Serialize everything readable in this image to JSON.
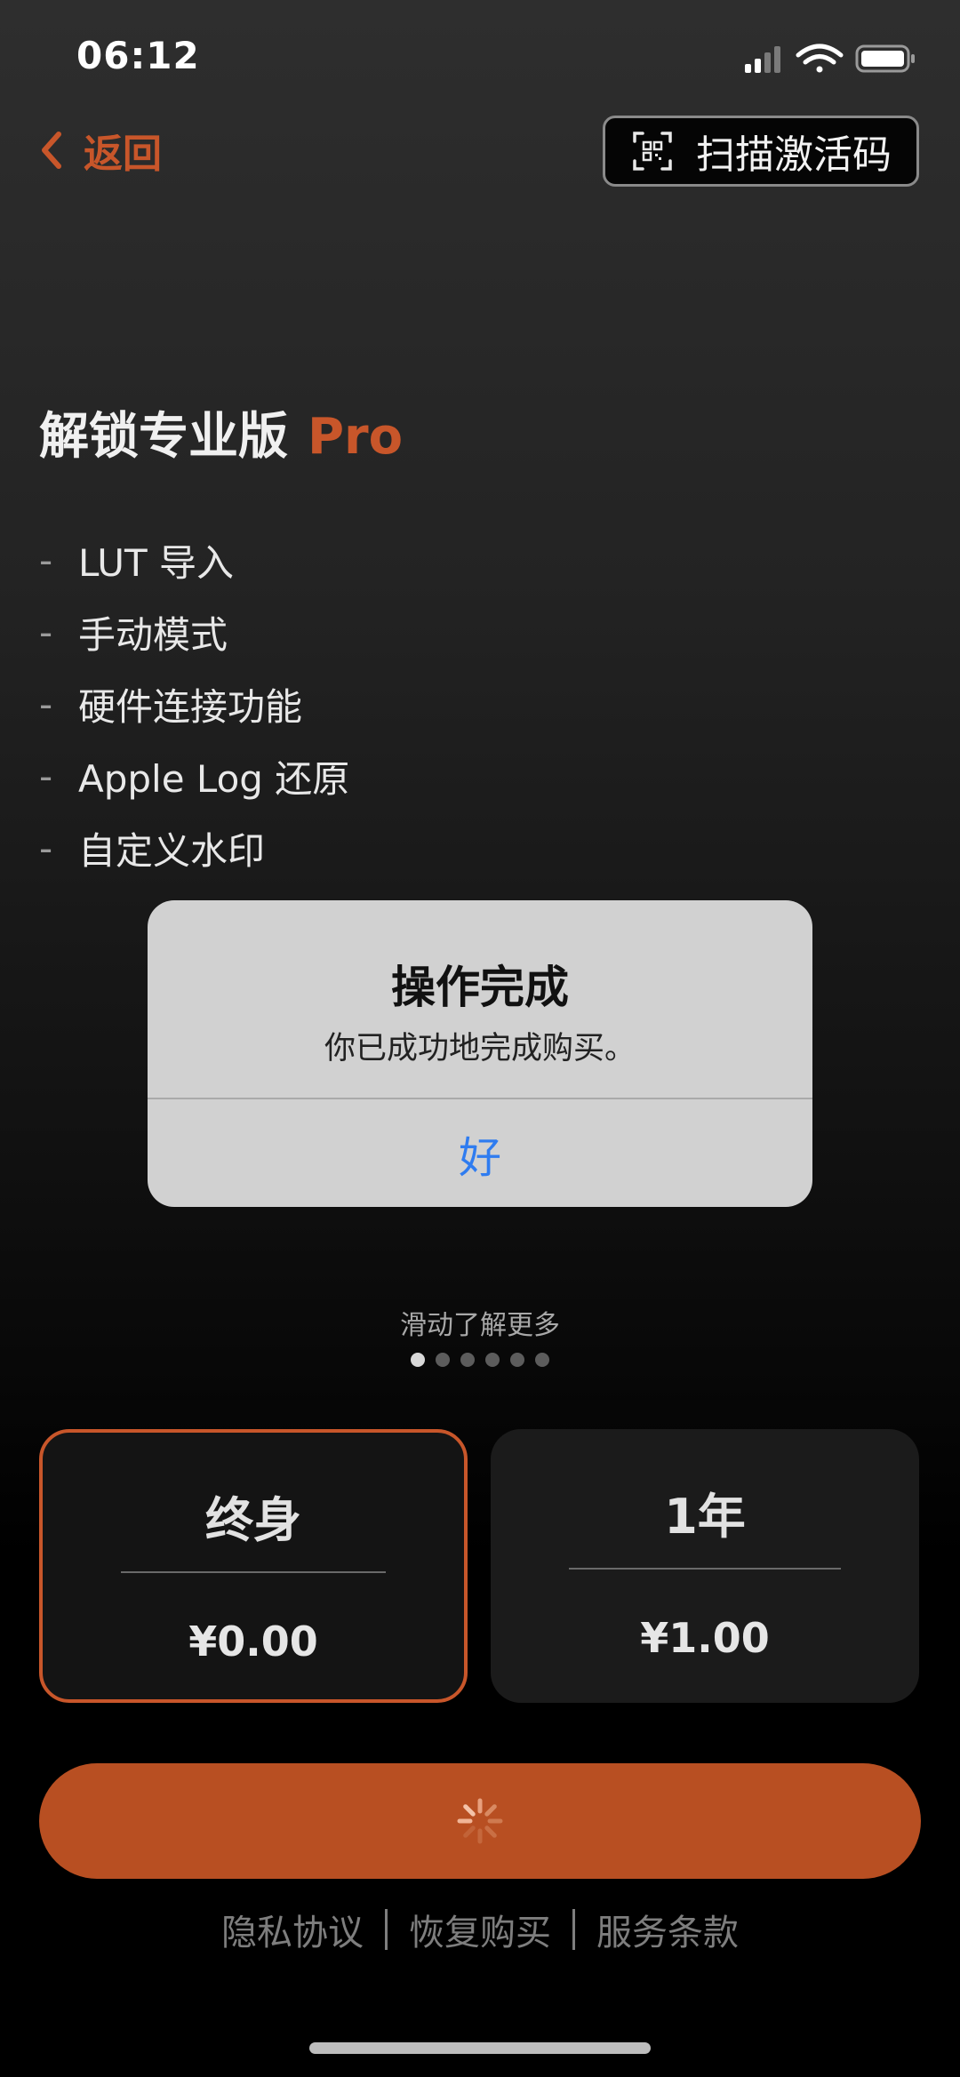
{
  "status_bar": {
    "time": "06:12",
    "icons": [
      "signal-icon",
      "wifi-icon",
      "battery-icon"
    ]
  },
  "nav": {
    "back_label": "返回",
    "back_icon": "chevron-left-icon",
    "scan_label": "扫描激活码",
    "scan_icon": "qr-scan-icon"
  },
  "headline": {
    "text": "解锁专业版",
    "accent": "Pro"
  },
  "features": [
    {
      "dash": "-",
      "text": "LUT 导入"
    },
    {
      "dash": "-",
      "text": "手动模式"
    },
    {
      "dash": "-",
      "text": "硬件连接功能"
    },
    {
      "dash": "-",
      "text": "Apple Log 还原"
    },
    {
      "dash": "-",
      "text": "自定义水印"
    }
  ],
  "alert": {
    "title": "操作完成",
    "message": "你已成功地完成购买。",
    "ok_label": "好"
  },
  "pager": {
    "hint": "滑动了解更多",
    "page_count": 6,
    "current_page": 1
  },
  "plans": [
    {
      "name": "终身",
      "price": "¥0.00",
      "selected": true
    },
    {
      "name": "1年",
      "price": "¥1.00",
      "selected": false
    }
  ],
  "purchase_button": {
    "state": "loading",
    "icon": "spinner-icon"
  },
  "footer": {
    "privacy": "隐私协议",
    "restore": "恢复购买",
    "terms": "服务条款"
  },
  "colors": {
    "accent": "#c8562a",
    "button": "#b84f22",
    "alert_bg": "#d1d1d1",
    "link_blue": "#2f7cf0"
  }
}
